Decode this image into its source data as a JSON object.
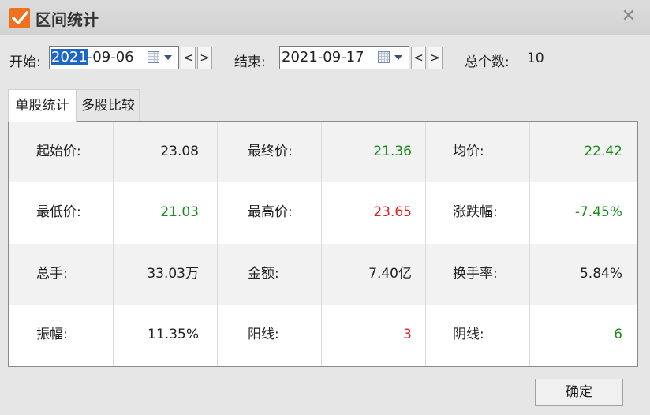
{
  "window": {
    "title": "区间统计",
    "close_glyph": "✕"
  },
  "filters": {
    "start_label": "开始:",
    "start_date_selected": "2021",
    "start_date_rest": "-09-06",
    "end_label": "结束:",
    "end_date": "2021-09-17",
    "prev_glyph": "<",
    "next_glyph": ">",
    "count_label": "总个数:",
    "count_value": "10"
  },
  "tabs": [
    {
      "label": "单股统计",
      "active": true
    },
    {
      "label": "多股比较",
      "active": false
    }
  ],
  "stats": [
    [
      {
        "label": "起始价:",
        "value": "23.08",
        "color": "#222222"
      },
      {
        "label": "最终价:",
        "value": "21.36",
        "color": "#1a8a1a"
      },
      {
        "label": "均价:",
        "value": "22.42",
        "color": "#1a8a1a"
      }
    ],
    [
      {
        "label": "最低价:",
        "value": "21.03",
        "color": "#1a8a1a"
      },
      {
        "label": "最高价:",
        "value": "23.65",
        "color": "#e02020"
      },
      {
        "label": "涨跌幅:",
        "value": "-7.45%",
        "color": "#1a8a1a"
      }
    ],
    [
      {
        "label": "总手:",
        "value": "33.03万",
        "color": "#222222"
      },
      {
        "label": "金额:",
        "value": "7.40亿",
        "color": "#222222"
      },
      {
        "label": "换手率:",
        "value": "5.84%",
        "color": "#222222"
      }
    ],
    [
      {
        "label": "振幅:",
        "value": "11.35%",
        "color": "#222222"
      },
      {
        "label": "阳线:",
        "value": "3",
        "color": "#e02020"
      },
      {
        "label": "阴线:",
        "value": "6",
        "color": "#1a8a1a"
      }
    ]
  ],
  "footer": {
    "ok_label": "确定"
  }
}
